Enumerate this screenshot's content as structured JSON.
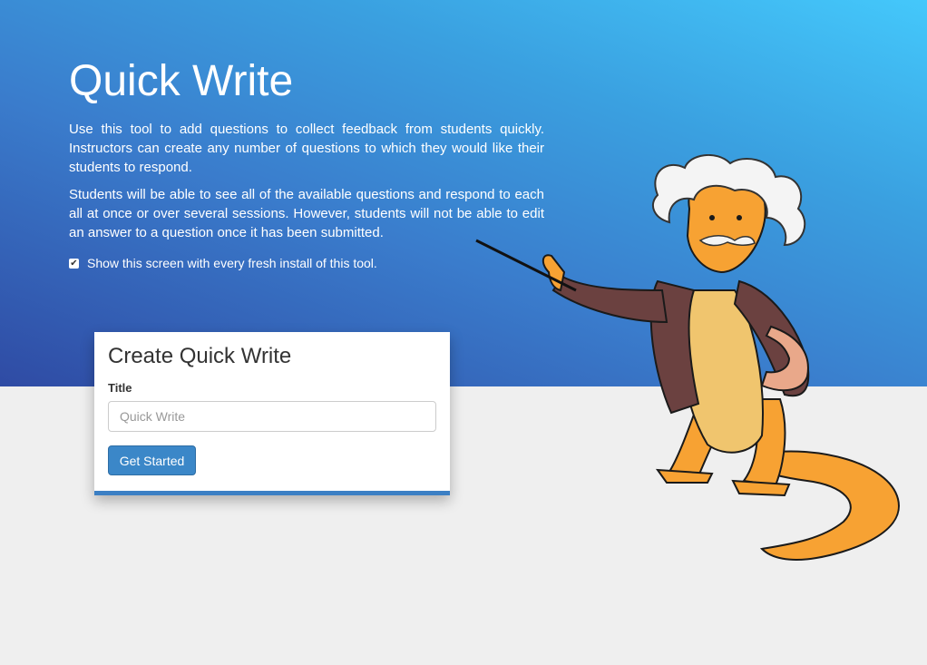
{
  "hero": {
    "title": "Quick Write",
    "paragraph1": "Use this tool to add questions to collect feedback from students quickly. Instructors can create any number of questions to which they would like their students to respond.",
    "paragraph2": "Students will be able to see all of the available questions and respond to each all at once or over several sessions. However, students will not be able to edit an answer to a question once it has been submitted.",
    "show_screen_label": "Show this screen with every fresh install of this tool.",
    "show_screen_checked": true
  },
  "card": {
    "heading": "Create Quick Write",
    "title_label": "Title",
    "title_value": "",
    "title_placeholder": "Quick Write",
    "get_started_label": "Get Started"
  },
  "colors": {
    "hero_gradient_start": "#44c8fb",
    "hero_gradient_end": "#2f4ba4",
    "button": "#3b87c8",
    "page_bg": "#efefef"
  },
  "icons": {
    "checkbox": "check-icon",
    "mascot": "dragon-professor-illustration"
  }
}
